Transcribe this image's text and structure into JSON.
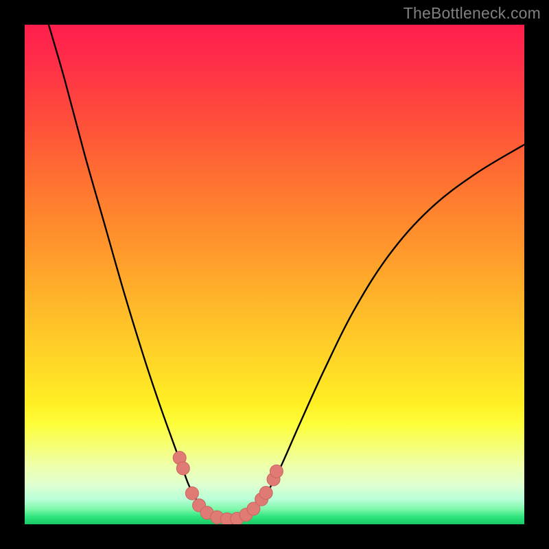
{
  "watermark": "TheBottleneck.com",
  "colors": {
    "background": "#000000",
    "watermark": "#808080",
    "curve_stroke": "#000000",
    "marker_fill": "#e07a74",
    "marker_stroke": "#c9645f",
    "gradient_top": "#ff1e4c",
    "gradient_bottom": "#18c865"
  },
  "chart_data": {
    "type": "line",
    "title": "",
    "xlabel": "",
    "ylabel": "",
    "xlim": [
      0,
      100
    ],
    "ylim": [
      0,
      100
    ],
    "note": "No axes or ticks are rendered; values below are the screen-space coordinates (0–100 each axis, origin top-left of the gradient plot area) of the drawn curve and markers as read from the image.",
    "series": [
      {
        "name": "bottleneck-curve",
        "kind": "curve",
        "points": [
          {
            "x": 4.8,
            "y": 0.0
          },
          {
            "x": 8.0,
            "y": 11.0
          },
          {
            "x": 12.0,
            "y": 26.0
          },
          {
            "x": 16.0,
            "y": 40.0
          },
          {
            "x": 20.0,
            "y": 54.0
          },
          {
            "x": 24.0,
            "y": 67.0
          },
          {
            "x": 27.0,
            "y": 76.0
          },
          {
            "x": 29.5,
            "y": 83.0
          },
          {
            "x": 31.5,
            "y": 88.5
          },
          {
            "x": 33.0,
            "y": 92.5
          },
          {
            "x": 35.0,
            "y": 96.0
          },
          {
            "x": 37.0,
            "y": 98.0
          },
          {
            "x": 40.0,
            "y": 99.0
          },
          {
            "x": 43.0,
            "y": 99.0
          },
          {
            "x": 45.5,
            "y": 97.5
          },
          {
            "x": 48.0,
            "y": 94.5
          },
          {
            "x": 51.0,
            "y": 89.0
          },
          {
            "x": 55.0,
            "y": 80.0
          },
          {
            "x": 60.0,
            "y": 69.0
          },
          {
            "x": 66.0,
            "y": 57.0
          },
          {
            "x": 73.0,
            "y": 46.0
          },
          {
            "x": 81.0,
            "y": 37.0
          },
          {
            "x": 90.0,
            "y": 30.0
          },
          {
            "x": 100.0,
            "y": 24.0
          }
        ]
      },
      {
        "name": "markers",
        "kind": "points",
        "points": [
          {
            "x": 31.0,
            "y": 86.7
          },
          {
            "x": 31.7,
            "y": 88.8
          },
          {
            "x": 33.5,
            "y": 93.8
          },
          {
            "x": 34.9,
            "y": 96.2
          },
          {
            "x": 36.5,
            "y": 97.7
          },
          {
            "x": 38.5,
            "y": 98.6
          },
          {
            "x": 40.5,
            "y": 99.0
          },
          {
            "x": 42.5,
            "y": 98.9
          },
          {
            "x": 44.3,
            "y": 98.1
          },
          {
            "x": 45.8,
            "y": 96.9
          },
          {
            "x": 47.4,
            "y": 95.0
          },
          {
            "x": 48.3,
            "y": 93.7
          },
          {
            "x": 49.8,
            "y": 91.0
          },
          {
            "x": 50.4,
            "y": 89.4
          }
        ]
      }
    ]
  }
}
